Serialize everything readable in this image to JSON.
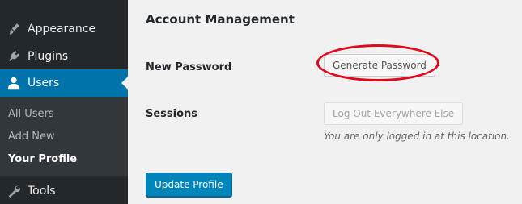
{
  "sidebar": {
    "menu": [
      {
        "label": "Appearance",
        "icon": "paintbrush-icon"
      },
      {
        "label": "Plugins",
        "icon": "plugin-icon"
      },
      {
        "label": "Users",
        "icon": "users-icon"
      },
      {
        "label": "Tools",
        "icon": "wrench-icon"
      }
    ],
    "submenu": [
      {
        "label": "All Users"
      },
      {
        "label": "Add New"
      },
      {
        "label": "Your Profile"
      }
    ]
  },
  "main": {
    "section_title": "Account Management",
    "new_password": {
      "label": "New Password",
      "button": "Generate Password"
    },
    "sessions": {
      "label": "Sessions",
      "button": "Log Out Everywhere Else",
      "description": "You are only logged in at this location."
    },
    "update_button": "Update Profile"
  },
  "colors": {
    "sidebar_bg": "#23282d",
    "submenu_bg": "#32373c",
    "accent": "#0073aa",
    "primary_button": "#0085ba",
    "annotation": "#e0081d"
  }
}
